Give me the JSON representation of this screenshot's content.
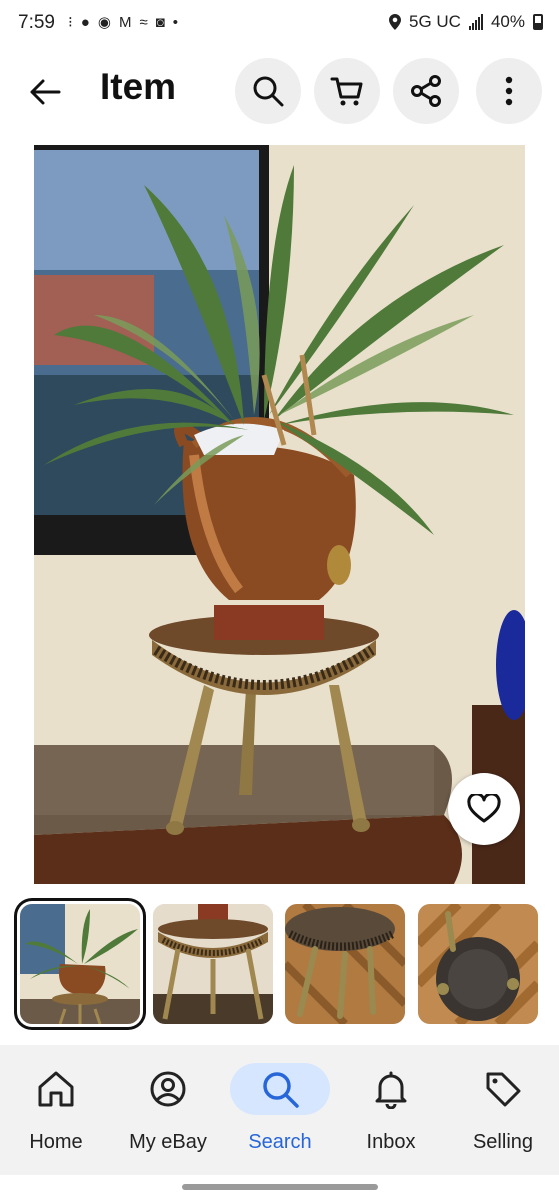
{
  "status_bar": {
    "time": "7:59",
    "network": "5G UC",
    "battery": "40%"
  },
  "app_bar": {
    "title": "Item",
    "back_icon": "arrow-left-icon",
    "actions": [
      "search-icon",
      "cart-icon",
      "share-icon",
      "more-vertical-icon"
    ]
  },
  "gallery": {
    "thumbnails": [
      {
        "icon": "thumbnail-plant-on-stand",
        "selected": true
      },
      {
        "icon": "thumbnail-stand-side",
        "selected": false
      },
      {
        "icon": "thumbnail-stand-underside",
        "selected": false
      },
      {
        "icon": "thumbnail-stand-bottom",
        "selected": false
      }
    ]
  },
  "bottom_nav": {
    "items": [
      {
        "label": "Home",
        "icon": "home-icon"
      },
      {
        "label": "My eBay",
        "icon": "account-icon"
      },
      {
        "label": "Search",
        "icon": "search-icon",
        "active": true
      },
      {
        "label": "Inbox",
        "icon": "bell-icon"
      },
      {
        "label": "Selling",
        "icon": "tag-icon"
      }
    ]
  },
  "colors": {
    "accent": "#2766d8",
    "active_pill": "#d6e6ff",
    "icon_button_bg": "#eeeeee",
    "nav_bg": "#f2f2f2"
  }
}
